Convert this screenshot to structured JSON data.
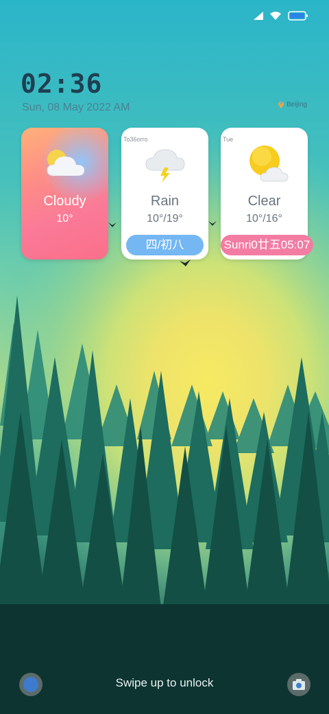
{
  "status_bar": {
    "icons": [
      "signal-icon",
      "wifi-icon",
      "battery-icon"
    ]
  },
  "lockscreen": {
    "time": "02:36",
    "date": "Sun, 08 May 2022 AM",
    "location": "Beijing"
  },
  "cards": [
    {
      "corner_label": "",
      "condition": "Cloudy",
      "temperature": "10°",
      "icon": "cloudy-icon",
      "pill": ""
    },
    {
      "corner_label": "To36orro",
      "condition": "Rain",
      "temperature": "10°/19°",
      "icon": "thunder-rain-icon",
      "pill": "四/初八"
    },
    {
      "corner_label": "Tue",
      "condition": "Clear",
      "temperature": "10°/16°",
      "icon": "sun-cloud-icon",
      "pill": "Sunri0廿五05:07"
    }
  ],
  "bottom": {
    "unlock_hint": "Swipe up to unlock",
    "left_icon": "assistant-icon",
    "right_icon": "camera-icon"
  },
  "colors": {
    "sky_top": "#2fb6c8",
    "sun": "#f0e060",
    "forest": "#0f4a42",
    "pill_blue": "#74b7f3",
    "pill_pink": "#f37ca3"
  }
}
